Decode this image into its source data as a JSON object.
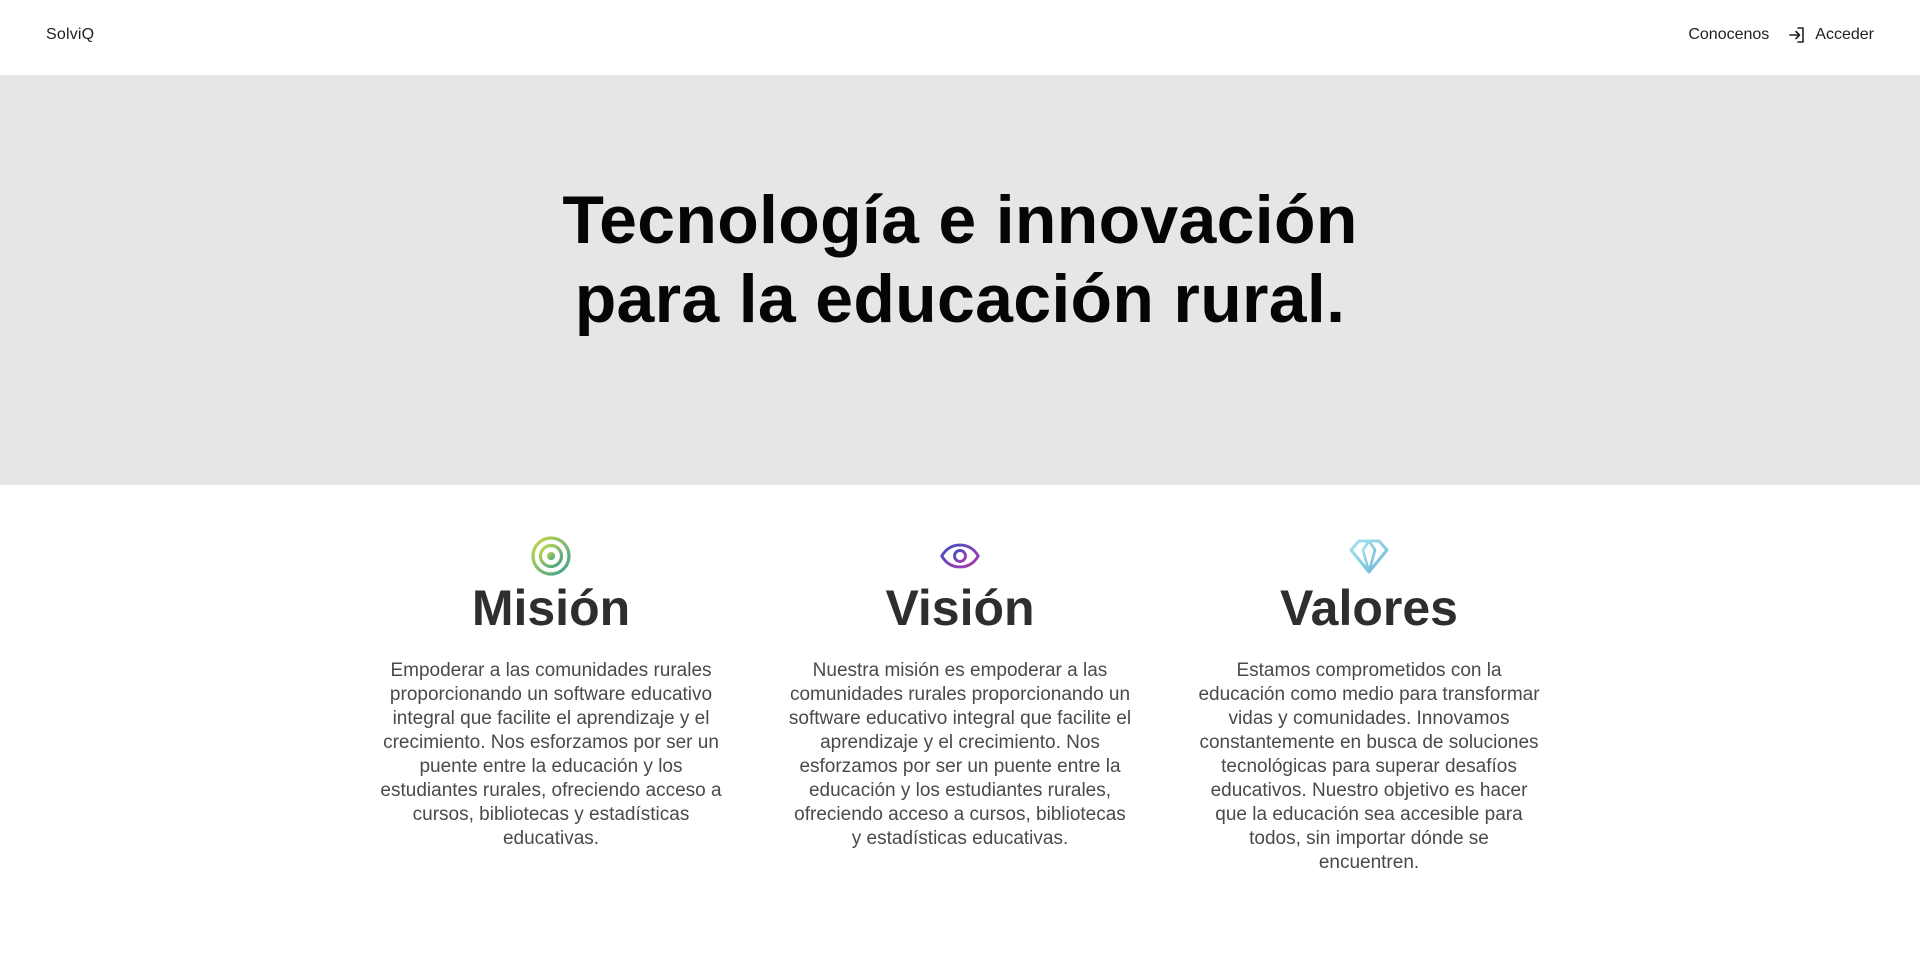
{
  "header": {
    "brand": "SolviQ",
    "nav_about": "Conocenos",
    "nav_login": "Acceder",
    "login_icon": "login-icon"
  },
  "hero": {
    "line1": "Tecnología e innovación",
    "line2": "para la educación rural."
  },
  "features": [
    {
      "icon": "target-icon",
      "title": "Misión",
      "text": "Empoderar a las comunidades rurales proporcionando un software educativo integral que facilite el aprendizaje y el crecimiento. Nos esforzamos por ser un puente entre la educación y los estudiantes rurales, ofreciendo acceso a cursos, bibliotecas y estadísticas educativas."
    },
    {
      "icon": "eye-icon",
      "title": "Visión",
      "text": "Nuestra misión es empoderar a las comunidades rurales proporcionando un software educativo integral que facilite el aprendizaje y el crecimiento. Nos esforzamos por ser un puente entre la educación y los estudiantes rurales, ofreciendo acceso a cursos, bibliotecas y estadísticas educativas."
    },
    {
      "icon": "diamond-icon",
      "title": "Valores",
      "text": "Estamos comprometidos con la educación como medio para transformar vidas y comunidades. Innovamos constantemente en busca de soluciones tecnológicas para superar desafíos educativos. Nuestro objetivo es hacer que la educación sea accesible para todos, sin importar dónde se encuentren."
    }
  ],
  "colors": {
    "hero_bg": "#e6e6e6",
    "target_gradient": [
      "#c6d94a",
      "#3ea08a"
    ],
    "eye_gradient": [
      "#3f4fc0",
      "#b03ab0"
    ],
    "diamond_gradient": [
      "#8fd9e8",
      "#6fb6d6"
    ]
  }
}
